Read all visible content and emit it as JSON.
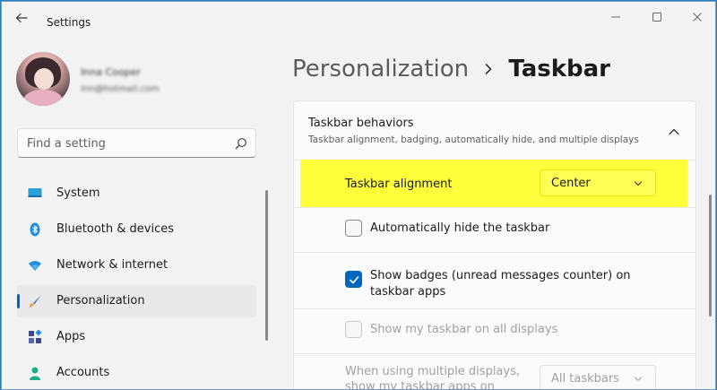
{
  "window": {
    "title": "Settings",
    "controls": [
      "minimize-icon",
      "maximize-icon",
      "close-icon"
    ]
  },
  "profile": {
    "name": "Inna Cooper",
    "email": "inn@hotmail.com"
  },
  "search": {
    "placeholder": "Find a setting"
  },
  "sidebar": {
    "items": [
      {
        "label": "System",
        "icon": "system-icon"
      },
      {
        "label": "Bluetooth & devices",
        "icon": "bluetooth-icon"
      },
      {
        "label": "Network & internet",
        "icon": "network-icon"
      },
      {
        "label": "Personalization",
        "icon": "personalization-icon",
        "active": true
      },
      {
        "label": "Apps",
        "icon": "apps-icon"
      },
      {
        "label": "Accounts",
        "icon": "accounts-icon"
      }
    ]
  },
  "breadcrumb": {
    "parent": "Personalization",
    "current": "Taskbar"
  },
  "section": {
    "title": "Taskbar behaviors",
    "subtitle": "Taskbar alignment, badging, automatically hide, and multiple displays",
    "settings": {
      "alignment": {
        "label": "Taskbar alignment",
        "value": "Center"
      },
      "autohide": {
        "label": "Automatically hide the taskbar",
        "checked": false
      },
      "badges": {
        "label_line1": "Show badges (unread messages counter) on",
        "label_line2": "taskbar apps",
        "checked": true
      },
      "all_displays": {
        "label": "Show my taskbar on all displays",
        "checked": false,
        "disabled": true
      },
      "multi_display": {
        "label_line1": "When using multiple displays,",
        "label_line2": "show my taskbar apps on",
        "value": "All taskbars",
        "disabled": true
      }
    }
  },
  "colors": {
    "accent": "#0067c0",
    "highlight": "#ffff3c",
    "background": "#f3f3f3"
  }
}
